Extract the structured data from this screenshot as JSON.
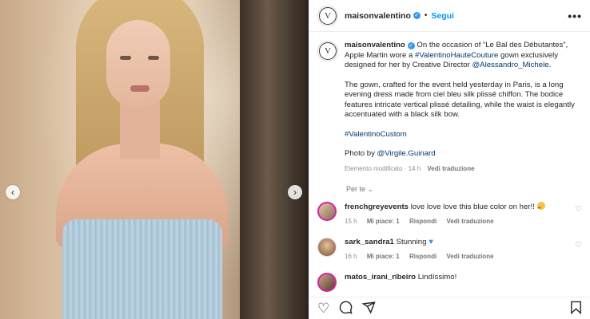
{
  "header": {
    "username": "maisonvalentino",
    "logo_letter": "V",
    "separator": "•",
    "follow_label": "Segui",
    "more_icon": "ellipsis-icon"
  },
  "photo": {
    "prev_arrow": "‹",
    "next_arrow": "›"
  },
  "caption": {
    "username": "maisonvalentino",
    "p1_a": " On the occasion of “Le Bal des Débutantes”, Apple Martin wore a ",
    "p1_tag": "#ValentinoHauteCouture",
    "p1_b": " gown exclusively designed for her by Creative Director ",
    "p1_mention": "@Alessandro_Michele",
    "p1_c": ".",
    "p2": "The gown, crafted for the event held yesterday in Paris, is a long evening dress made from ciel bleu silk plissé chiffon. The bodice features intricate vertical plissé detailing, while the waist is elegantly accentuated with a black silk bow.",
    "p3_tag": "#ValentinoCustom",
    "p4_a": "Photo by ",
    "p4_mention": "@Virgile.Guinard",
    "meta_edited": "Elemento modificato · 14 h",
    "meta_translate": "Vedi traduzione"
  },
  "comments_header": "Per te ⌄",
  "comments": [
    {
      "username": "frenchgreyevents",
      "text": " love love love this blue color on her!! ",
      "time": "15 h",
      "likes": "Mi piace: 1",
      "reply": "Rispondi",
      "translate": "Vedi traduzione"
    },
    {
      "username": "sark_sandra1",
      "text": " Stunning ",
      "time": "16 h",
      "likes": "Mi piace: 1",
      "reply": "Rispondi",
      "translate": "Vedi traduzione"
    },
    {
      "username": "matos_irani_ribeiro",
      "text": " Lindíssimo!"
    }
  ],
  "icons": {
    "like": "heart-icon",
    "comment": "comment-icon",
    "share": "paper-plane-icon",
    "save": "bookmark-icon"
  },
  "colors": {
    "link": "#00376b",
    "follow": "#0095f6",
    "verified": "#3897f0"
  }
}
